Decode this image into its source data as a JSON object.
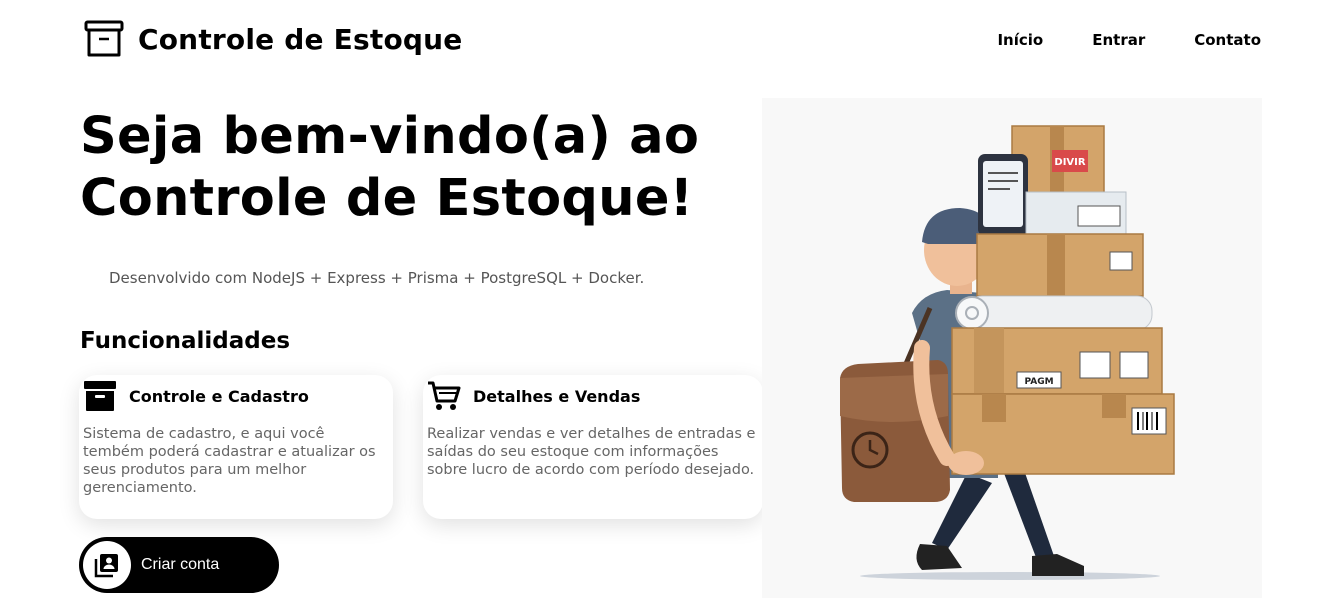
{
  "header": {
    "app_title": "Controle de Estoque",
    "logo_icon": "archive-box-icon",
    "nav": [
      "Início",
      "Entrar",
      "Contato"
    ]
  },
  "hero": {
    "title": "Seja bem-vindo(a) ao Controle de Estoque!",
    "tech_stack": "Desenvolvido com NodeJS + Express + Prisma + PostgreSQL + Docker."
  },
  "features": {
    "section_title": "Funcionalidades",
    "cards": [
      {
        "icon": "archive-icon",
        "title": "Controle e Cadastro",
        "text": "Sistema de cadastro, e aqui você tembém poderá cadastrar e atualizar os seus produtos para um melhor gerenciamento."
      },
      {
        "icon": "shopping-cart-icon",
        "title": "Detalhes e Vendas",
        "text": "Realizar vendas e ver detalhes de entradas e saídas do seu estoque com informações sobre lucro de acordo com período desejado."
      }
    ]
  },
  "cta": {
    "label": "Criar conta",
    "icon": "account-box-icon"
  },
  "illustration": {
    "box_label": "DIVIR",
    "stamp_label": "PAGM"
  },
  "colors": {
    "primary": "#000000",
    "text_muted": "#666666",
    "cardboard": "#d3a46a",
    "shirt": "#5b7086",
    "cap": "#4b5d78"
  }
}
